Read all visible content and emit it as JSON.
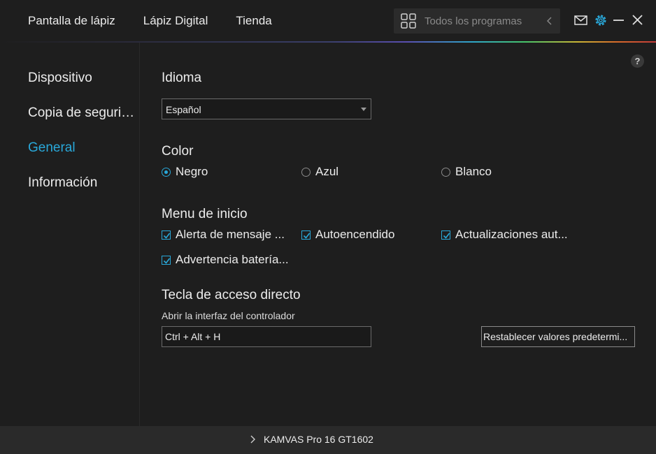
{
  "topnav": [
    "Pantalla de lápiz",
    "Lápiz Digital",
    "Tienda"
  ],
  "search": {
    "placeholder": "Todos los programas"
  },
  "icons": {
    "apps": "grid-icon",
    "back": "chevron-left-icon",
    "mail": "mail-icon",
    "settings": "gear-icon",
    "minimize": "minimize-icon",
    "close": "close-icon",
    "help": "?"
  },
  "sidebar": {
    "items": [
      {
        "label": "Dispositivo"
      },
      {
        "label": "Copia de seguridad"
      },
      {
        "label": "General"
      },
      {
        "label": "Información"
      }
    ],
    "active": "General"
  },
  "language": {
    "title": "Idioma",
    "value": "Español"
  },
  "color": {
    "title": "Color",
    "options": [
      "Negro",
      "Azul",
      "Blanco"
    ],
    "selected": "Negro"
  },
  "startup": {
    "title": "Menu de inicio",
    "options": [
      {
        "label": "Alerta de mensaje ...",
        "checked": true
      },
      {
        "label": "Autoencendido",
        "checked": true
      },
      {
        "label": "Actualizaciones aut...",
        "checked": true
      },
      {
        "label": "Advertencia batería...",
        "checked": true
      }
    ]
  },
  "hotkey": {
    "title": "Tecla de acceso directo",
    "label": "Abrir la interfaz del controlador",
    "value": "Ctrl + Alt + H",
    "reset_label": "Restablecer valores predetermi..."
  },
  "footer": {
    "device": "KAMVAS Pro 16 GT1602"
  },
  "colors": {
    "accent": "#29a8d9",
    "background": "#1e1e1e",
    "footer": "#2a2a2a"
  }
}
